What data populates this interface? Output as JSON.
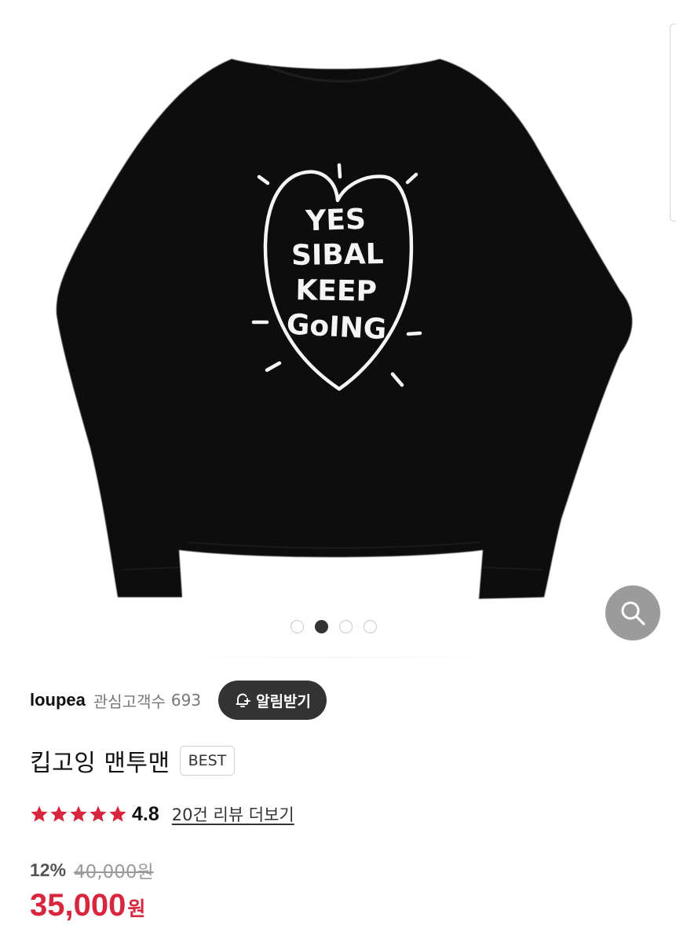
{
  "gallery": {
    "print_lines": [
      "YES",
      "SIBAL",
      "KEEP",
      "GoING"
    ],
    "image_count": 4,
    "active_index": 1
  },
  "store": {
    "name": "loupea",
    "favorite_label": "관심고객수",
    "favorite_count": "693",
    "notify_label": "알림받기"
  },
  "product": {
    "title": "킵고잉 맨투맨",
    "badge": "BEST"
  },
  "rating": {
    "value": "4.8",
    "stars": 5,
    "review_link": "20건 리뷰 더보기"
  },
  "price": {
    "discount": "12%",
    "original": "40,000원",
    "sale": "35,000",
    "currency": "원"
  },
  "colors": {
    "accent": "#d7263d",
    "dark_button": "#333333",
    "zoom_button": "#9b9b9b",
    "garment": "#0c0c0c"
  },
  "icons": {
    "zoom": "search-icon",
    "notify": "bell-plus-icon",
    "star": "star-icon"
  }
}
